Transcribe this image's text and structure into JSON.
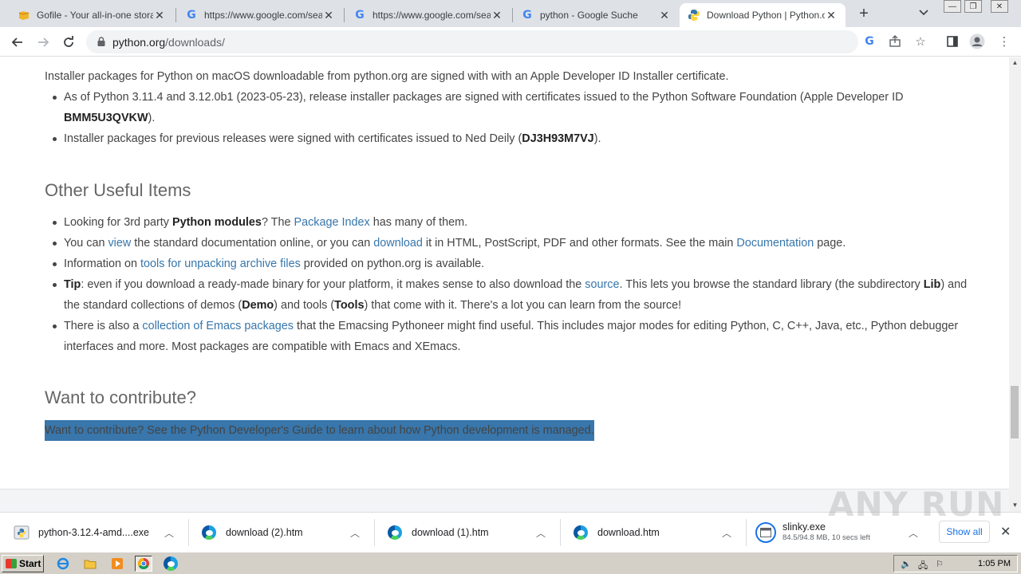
{
  "tabs": [
    {
      "title": "Gofile - Your all-in-one storage",
      "icon": "gofile-icon",
      "active": false
    },
    {
      "title": "https://www.google.com/search",
      "icon": "google-icon",
      "active": false
    },
    {
      "title": "https://www.google.com/search",
      "icon": "google-icon",
      "active": false
    },
    {
      "title": "python - Google Suche",
      "icon": "google-icon",
      "active": false
    },
    {
      "title": "Download Python | Python.org",
      "icon": "python-icon",
      "active": true
    }
  ],
  "address_bar": {
    "domain": "python.org",
    "path": "/downloads/"
  },
  "page": {
    "intro": "Installer packages for Python on macOS downloadable from python.org are signed with with an Apple Developer ID Installer certificate.",
    "signing_items": [
      {
        "pre": "As of Python 3.11.4 and 3.12.0b1 (2023-05-23), release installer packages are signed with certificates issued to the Python Software Foundation (Apple Developer ID ",
        "bold": "BMM5U3QVKW",
        "post": ")."
      },
      {
        "pre": "Installer packages for previous releases were signed with certificates issued to Ned Deily (",
        "bold": "DJ3H93M7VJ",
        "post": ")."
      }
    ],
    "useful_heading": "Other Useful Items",
    "useful": {
      "i1_a": "Looking for 3rd party ",
      "i1_b": "Python modules",
      "i1_c": "? The ",
      "i1_link": "Package Index",
      "i1_d": " has many of them.",
      "i2_a": "You can ",
      "i2_link1": "view",
      "i2_b": " the standard documentation online, or you can ",
      "i2_link2": "download",
      "i2_c": " it in HTML, PostScript, PDF and other formats. See the main ",
      "i2_link3": "Documentation",
      "i2_d": " page.",
      "i3_a": "Information on ",
      "i3_link": "tools for unpacking archive files",
      "i3_b": " provided on python.org is available.",
      "i4_bold1": "Tip",
      "i4_a": ": even if you download a ready-made binary for your platform, it makes sense to also download the ",
      "i4_link": "source",
      "i4_b": ". This lets you browse the standard library (the subdirectory ",
      "i4_bold2": "Lib",
      "i4_c": ") and the standard collections of demos (",
      "i4_bold3": "Demo",
      "i4_d": ") and tools (",
      "i4_bold4": "Tools",
      "i4_e": ") that come with it. There's a lot you can learn from the source!",
      "i5_a": "There is also a ",
      "i5_link": "collection of Emacs packages",
      "i5_b": " that the Emacsing Pythoneer might find useful. This includes major modes for editing Python, C, C++, Java, etc., Python debugger interfaces and more. Most packages are compatible with Emacs and XEmacs."
    },
    "contribute_heading": "Want to contribute?",
    "contribute_text": "Want to contribute? See the Python Developer's Guide to learn about how Python development is managed."
  },
  "downloads": [
    {
      "name": "python-3.12.4-amd....exe",
      "icon": "python-installer-icon"
    },
    {
      "name": "download (2).htm",
      "icon": "edge-icon"
    },
    {
      "name": "download (1).htm",
      "icon": "edge-icon"
    },
    {
      "name": "download.htm",
      "icon": "edge-icon"
    },
    {
      "name": "slinky.exe",
      "status": "84.5/94.8 MB, 10 secs left",
      "icon": "exe-icon"
    }
  ],
  "shelf": {
    "show_all": "Show all"
  },
  "watermark": "ANY RUN",
  "taskbar": {
    "start": "Start",
    "clock": "1:05 PM"
  },
  "colors": {
    "link": "#3776ab",
    "selection": "#3876ab",
    "tab_strip": "#dee1e6"
  }
}
